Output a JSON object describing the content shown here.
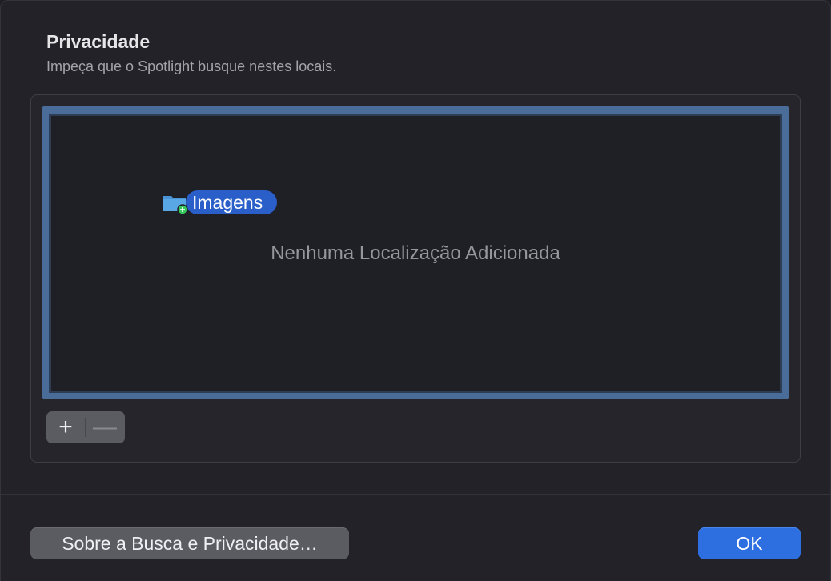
{
  "dialog": {
    "title": "Privacidade",
    "subtitle": "Impeça que o Spotlight busque nestes locais."
  },
  "list": {
    "empty_message": "Nenhuma Localização Adicionada",
    "dragging_item": {
      "label": "Imagens",
      "icon": "folder-icon",
      "badge": "plus-badge-icon"
    }
  },
  "controls": {
    "add_symbol": "+",
    "remove_symbol": "—"
  },
  "footer": {
    "about_label": "Sobre a Busca e Privacidade…",
    "ok_label": "OK"
  },
  "colors": {
    "accent": "#2d6ee0",
    "focus_ring": "#4a6c98",
    "drag_label": "#2a5fc9",
    "folder": "#5aa7e6",
    "badge": "#34c759"
  }
}
